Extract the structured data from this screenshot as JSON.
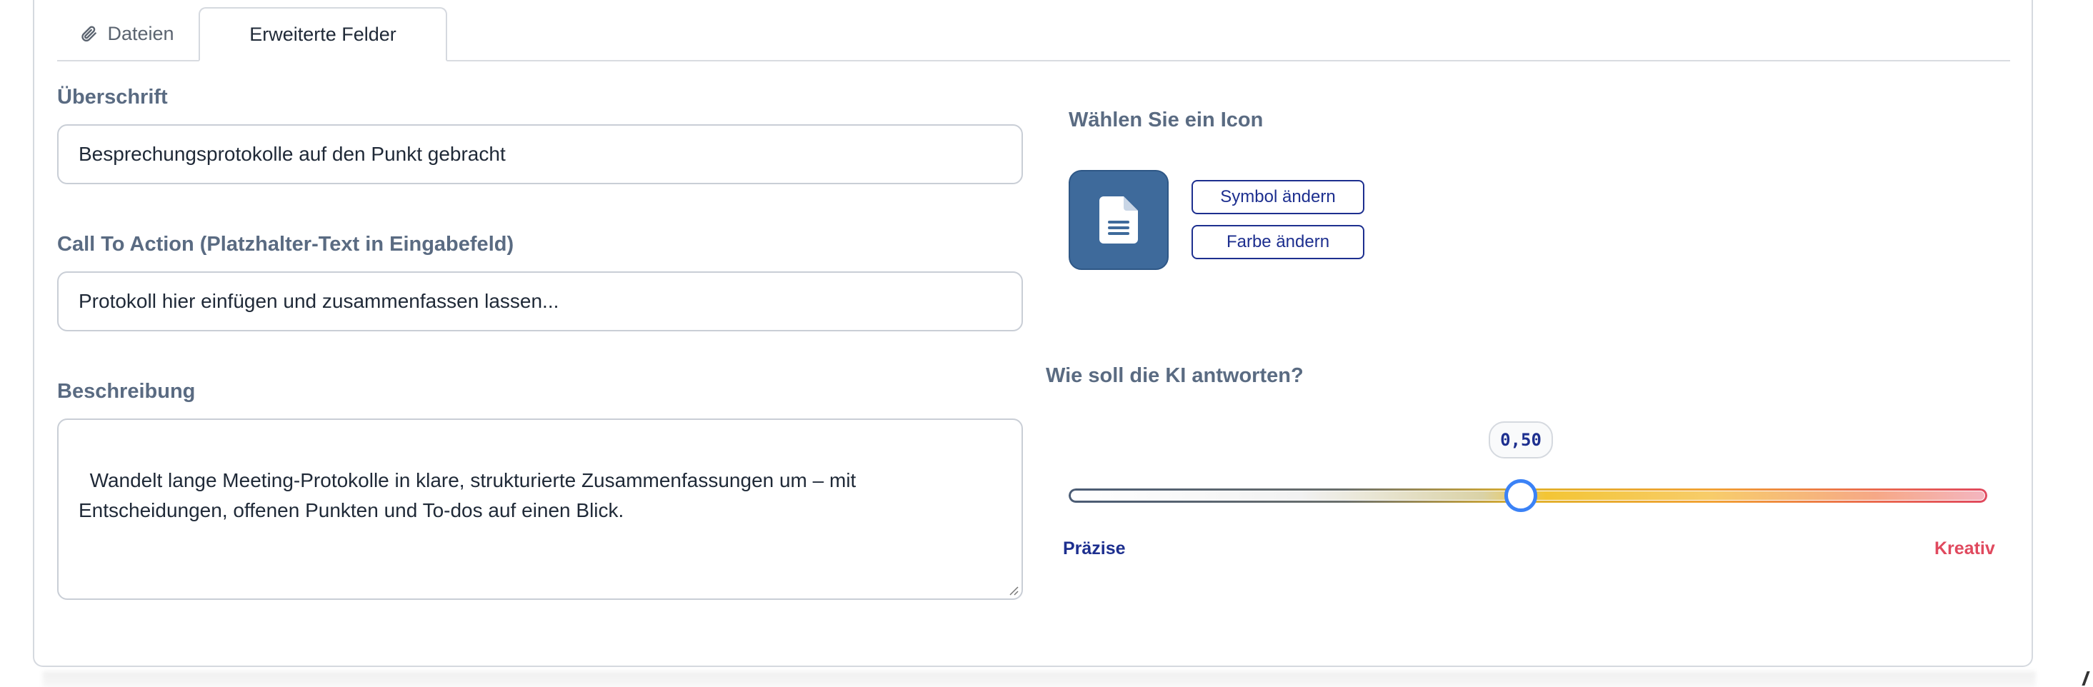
{
  "tabs": [
    {
      "label": "Dateien",
      "icon": "paperclip-icon"
    },
    {
      "label": "Erweiterte Felder",
      "active": true
    }
  ],
  "form": {
    "heading_label": "Überschrift",
    "heading_value": "Besprechungsprotokolle auf den Punkt gebracht",
    "cta_label": "Call To Action (Platzhalter-Text in Eingabefeld)",
    "cta_value": "Protokoll hier einfügen und zusammenfassen lassen...",
    "description_label": "Beschreibung",
    "description_value": "Wandelt lange Meeting-Protokolle in klare, strukturierte Zusammenfassungen um – mit\nEntscheidungen, offenen Punkten und To-dos auf einen Blick."
  },
  "icon_chooser": {
    "label": "Wählen Sie ein Icon",
    "icon": "document-icon",
    "tile_color": "#3e6a9b",
    "change_symbol_label": "Symbol ändern",
    "change_color_label": "Farbe ändern"
  },
  "ai_response": {
    "label": "Wie soll die KI antworten?",
    "value_display": "0,50",
    "value": 0.5,
    "min_label": "Präzise",
    "max_label": "Kreativ",
    "min_color": "#1d2f8f",
    "max_color": "#e0495e"
  }
}
